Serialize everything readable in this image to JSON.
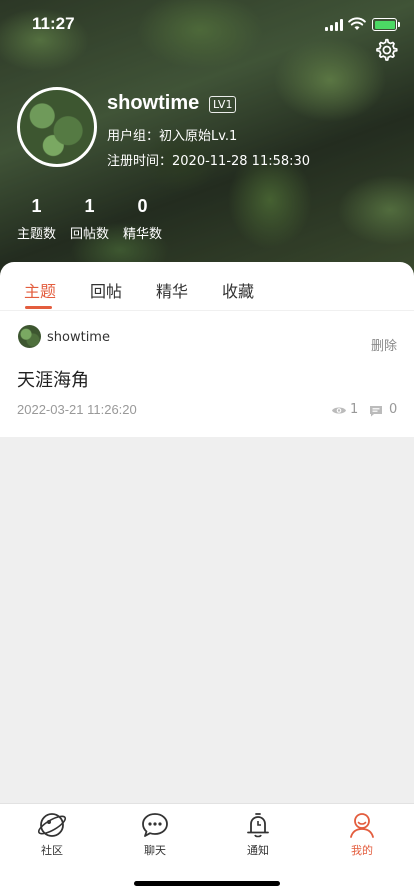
{
  "status": {
    "time": "11:27"
  },
  "profile": {
    "username": "showtime",
    "level_badge": "LV1",
    "user_group": "用户组：初入原始Lv.1",
    "register_time": "注册时间：2020-11-28 11:58:30",
    "stats": [
      {
        "value": "1",
        "label": "主题数"
      },
      {
        "value": "1",
        "label": "回帖数"
      },
      {
        "value": "0",
        "label": "精华数"
      }
    ]
  },
  "tabs": [
    {
      "label": "主题",
      "active": true
    },
    {
      "label": "回帖",
      "active": false
    },
    {
      "label": "精华",
      "active": false
    },
    {
      "label": "收藏",
      "active": false
    }
  ],
  "post": {
    "author": "showtime",
    "delete_label": "删除",
    "title": "天涯海角",
    "time": "2022-03-21 11:26:20",
    "views": "1",
    "comments": "0"
  },
  "tabbar": [
    {
      "label": "社区",
      "icon": "planet-icon",
      "active": false
    },
    {
      "label": "聊天",
      "icon": "chat-bubble-icon",
      "active": false
    },
    {
      "label": "通知",
      "icon": "bell-icon",
      "active": false
    },
    {
      "label": "我的",
      "icon": "person-icon",
      "active": true
    }
  ],
  "colors": {
    "accent": "#e35d3e",
    "badge_online": "#4cd964"
  }
}
